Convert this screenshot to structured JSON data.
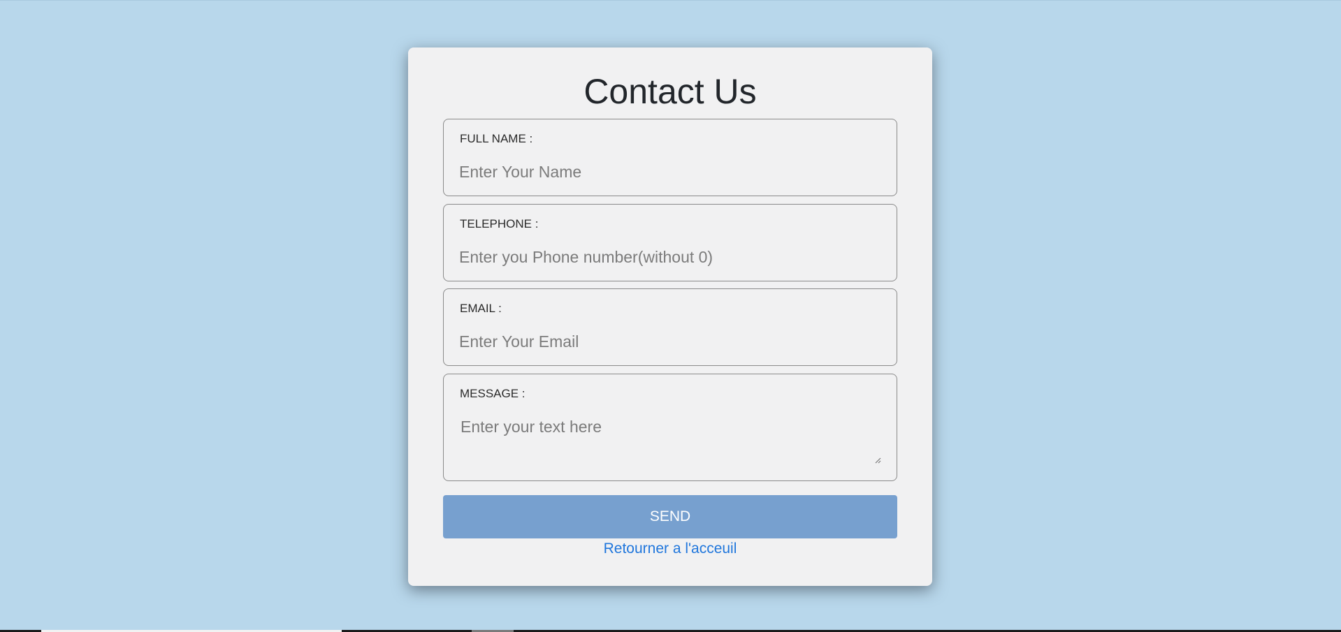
{
  "form": {
    "title": "Contact Us",
    "fields": [
      {
        "label": "FULL NAME :",
        "placeholder": "Enter Your Name",
        "value": ""
      },
      {
        "label": "TELEPHONE :",
        "placeholder": "Enter you Phone number(without 0)",
        "value": ""
      },
      {
        "label": "EMAIL :",
        "placeholder": "Enter Your Email",
        "value": ""
      },
      {
        "label": "MESSAGE :",
        "placeholder": "Enter your text here",
        "value": ""
      }
    ],
    "send_label": "SEND",
    "back_link": "Retourner a l'acceuil"
  },
  "colors": {
    "background": "#b8d7eb",
    "card": "#f1f1f2",
    "button": "#77a0cf",
    "link": "#1f76dc"
  }
}
